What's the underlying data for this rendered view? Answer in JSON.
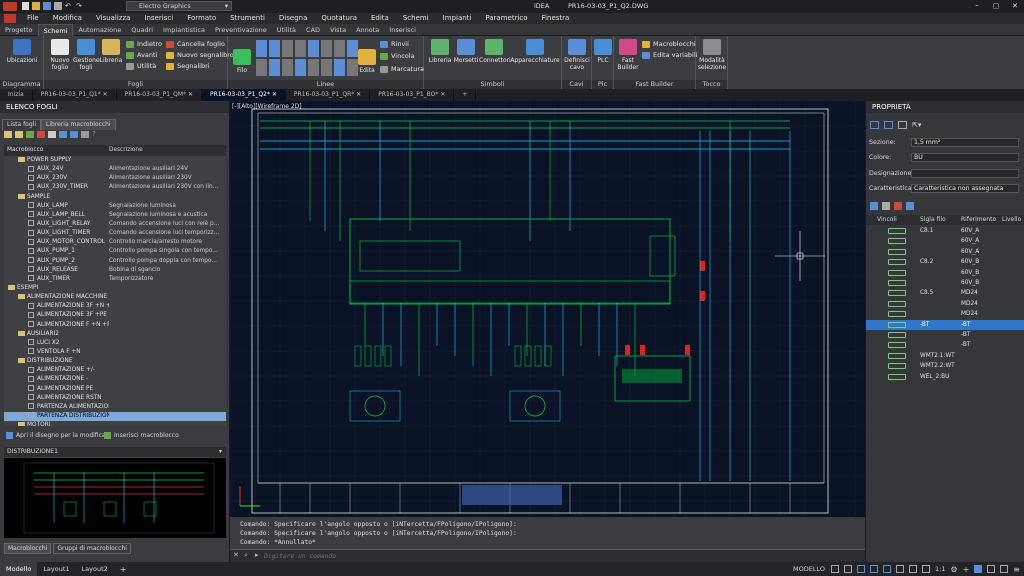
{
  "app": {
    "title": "iDEA",
    "file": "PR16-03-03_P1_Q2.DWG",
    "quick_label": "Electro Graphics"
  },
  "menu": [
    "File",
    "Modifica",
    "Visualizza",
    "Inserisci",
    "Formato",
    "Strumenti",
    "Disegna",
    "Quotatura",
    "Edita",
    "Schemi",
    "Impianti",
    "Parametrico",
    "Finestra"
  ],
  "ribbon_tabs": [
    "Progetto",
    "Schemi",
    "Automazione",
    "Quadri",
    "Impiantistica",
    "Preventivazione",
    "Utilità",
    "CAD",
    "Vista",
    "Annota",
    "Inserisci"
  ],
  "active_ribbon_tab": "Schemi",
  "ribbon": {
    "diagramma": {
      "label": "Diagramma",
      "ubicazioni": "Ubicazioni"
    },
    "fogli": {
      "label": "Fogli",
      "nuovo": "Nuovo foglio",
      "gestione": "Gestione fogli",
      "libreria": "Libreria",
      "indietro": "Indietro",
      "avanti": "Avanti",
      "utilita": "Utilità",
      "cancella": "Cancella foglio",
      "nuovo_segnalibro": "Nuovo segnalibro",
      "segnalibri": "Segnalibri"
    },
    "linee": {
      "label": "Linee",
      "filo": "Filo",
      "edita": "Edita",
      "rinvii": "Rinvii",
      "vincola": "Vincola",
      "marcatura": "Marcatura"
    },
    "simboli": {
      "label": "Simboli",
      "libreria": "Libreria",
      "morsetti": "Morsetti",
      "connettori": "Connettori",
      "apparecchiature": "Apparecchiature"
    },
    "cavi": {
      "label": "Cavi",
      "definisci": "Definisci cavo"
    },
    "plc": {
      "label": "Plc",
      "plc": "PLC"
    },
    "fastbuilder": {
      "label": "Fast Builder",
      "fast": "Fast Builder",
      "macroblocchi": "Macroblocchi",
      "edita_variabili": "Edita variabili"
    },
    "tocco": {
      "label": "Tocco",
      "modalita": "Modalità selezione"
    }
  },
  "doc_tabs": [
    "Inizia",
    "PR16-03-03_P1_Q1*",
    "PR16-03-03_P1_QM*",
    "PR16-03-03_P1_Q2*",
    "PR16-03-03_P1_QR*",
    "PR16-03-03_P1_BO*"
  ],
  "active_doc_tab": "PR16-03-03_P1_Q2*",
  "left": {
    "title": "ELENCO FOGLI",
    "tabs": [
      "Lista fogli",
      "Libreria macroblocchi"
    ],
    "col_macroblocco": "Macroblocco",
    "col_descrizione": "Descrizione",
    "rows": [
      {
        "n": "POWER SUPPLY",
        "d": "",
        "lvl": 1,
        "f": true
      },
      {
        "n": "AUX_24V",
        "d": "Alimentazione ausiliari 24V",
        "lvl": 2
      },
      {
        "n": "AUX_230V",
        "d": "Alimentazione ausiliari 230V",
        "lvl": 2
      },
      {
        "n": "AUX_230V_TIMER",
        "d": "Alimentazione ausiliari 230V con lin...",
        "lvl": 2
      },
      {
        "n": "SAMPLE",
        "d": "",
        "lvl": 1,
        "f": true
      },
      {
        "n": "AUX_LAMP",
        "d": "Segnalazione luminosa",
        "lvl": 2
      },
      {
        "n": "AUX_LAMP_BELL",
        "d": "Segnalazione luminosa e acustica",
        "lvl": 2
      },
      {
        "n": "AUX_LIGHT_RELAY",
        "d": "Comando accensione luci con relè p...",
        "lvl": 2
      },
      {
        "n": "AUX_LIGHT_TIMER",
        "d": "Comando accensione luci temporizz...",
        "lvl": 2
      },
      {
        "n": "AUX_MOTOR_CONTROL",
        "d": "Controllo marcia/arresto motore",
        "lvl": 2
      },
      {
        "n": "AUX_PUMP_1",
        "d": "Controllo pompa singola con tempo...",
        "lvl": 2
      },
      {
        "n": "AUX_PUMP_2",
        "d": "Controllo pompa doppia con tempo...",
        "lvl": 2
      },
      {
        "n": "AUX_RELEASE",
        "d": "Bobina di sgancio",
        "lvl": 2
      },
      {
        "n": "AUX_TIMER",
        "d": "Temporizzatore",
        "lvl": 2
      },
      {
        "n": "ESEMPI",
        "d": "",
        "lvl": 0,
        "f": true
      },
      {
        "n": "ALIMENTAZIONE MACCHINE",
        "d": "",
        "lvl": 1,
        "f": true
      },
      {
        "n": "ALIMENTAZIONE 3F +N +PE",
        "d": "",
        "lvl": 2
      },
      {
        "n": "ALIMENTAZIONE 3F +PE",
        "d": "",
        "lvl": 2
      },
      {
        "n": "ALIMENTAZIONE F +N +PE",
        "d": "",
        "lvl": 2
      },
      {
        "n": "AUSILIARI2",
        "d": "",
        "lvl": 1,
        "f": true
      },
      {
        "n": "LUCI X2",
        "d": "",
        "lvl": 2
      },
      {
        "n": "VENTOLA F +N",
        "d": "",
        "lvl": 2
      },
      {
        "n": "DISTRIBUZIONE",
        "d": "",
        "lvl": 1,
        "f": true
      },
      {
        "n": "ALIMENTAZIONE +/-",
        "d": "",
        "lvl": 2
      },
      {
        "n": "ALIMENTAZIONE -",
        "d": "",
        "lvl": 2
      },
      {
        "n": "ALIMENTAZIONE PE",
        "d": "",
        "lvl": 2
      },
      {
        "n": "ALIMENTAZIONE RSTN",
        "d": "",
        "lvl": 2
      },
      {
        "n": "PARTENZA ALIMENTAZIONE PLC",
        "d": "",
        "lvl": 2
      },
      {
        "n": "PARTENZA DISTRIBUZIONE",
        "d": "",
        "lvl": 2,
        "sel": true
      },
      {
        "n": "MOTORI",
        "d": "",
        "lvl": 1,
        "f": true
      }
    ],
    "open_link": "Apri il disegno per la modifica...",
    "insert_link": "Inserisci macroblocco",
    "preview_title": "DISTRIBUZIONE1",
    "bottom_tabs": [
      "Macroblocchi",
      "Gruppi di macroblocchi"
    ]
  },
  "canvas": {
    "viewport_label": "[-][Alto][Wireframe 2D]"
  },
  "cmd": {
    "lines": [
      "Comando: Specificare l'angolo opposto o [iNTercetta/FPoligono/IPoligono]:",
      "Comando: Specificare l'angolo opposto o [iNTercetta/FPoligono/IPoligono]:",
      "Comando: *Annullato*"
    ],
    "placeholder": "Digitare un comando"
  },
  "right": {
    "title": "PROPRIETÀ",
    "sezione_label": "Sezione:",
    "sezione_value": "1,5 mm²",
    "colore_label": "Colore:",
    "colore_value": "BU",
    "designazione_label": "Designazione:",
    "designazione_value": "",
    "caratteristica_label": "Caratteristica:",
    "caratteristica_value": "Caratteristica non assegnata",
    "cols": [
      "Vincoli",
      "Sigla filo",
      "Riferimento",
      "Livello"
    ],
    "rows": [
      {
        "v": "C8.1",
        "r": "60V_A"
      },
      {
        "v": "",
        "r": "60V_A"
      },
      {
        "v": "",
        "r": "60V_A"
      },
      {
        "v": "C8.2",
        "r": "60V_B"
      },
      {
        "v": "",
        "r": "60V_B"
      },
      {
        "v": "",
        "r": "60V_B"
      },
      {
        "v": "C8.5",
        "r": "MD24"
      },
      {
        "v": "",
        "r": "MD24"
      },
      {
        "v": "",
        "r": "MD24"
      },
      {
        "v": "-BT",
        "r": "-BT",
        "sel": true
      },
      {
        "v": "",
        "r": "-BT"
      },
      {
        "v": "",
        "r": "-BT"
      },
      {
        "v": "WMT2.1:WT",
        "r": ""
      },
      {
        "v": "WMT2.2:WT",
        "r": ""
      },
      {
        "v": "WEL_2:BU",
        "r": ""
      }
    ]
  },
  "status": {
    "tabs": [
      "Modello",
      "Layout1",
      "Layout2"
    ],
    "mode": "MODELLO",
    "scale": "1:1"
  },
  "colors": {
    "accent": "#2f77c8",
    "canvas_bg": "#0a1226",
    "wire_green": "#00d940",
    "wire_cyan": "#1ec8ff",
    "frame_white": "#e8e8e8"
  }
}
